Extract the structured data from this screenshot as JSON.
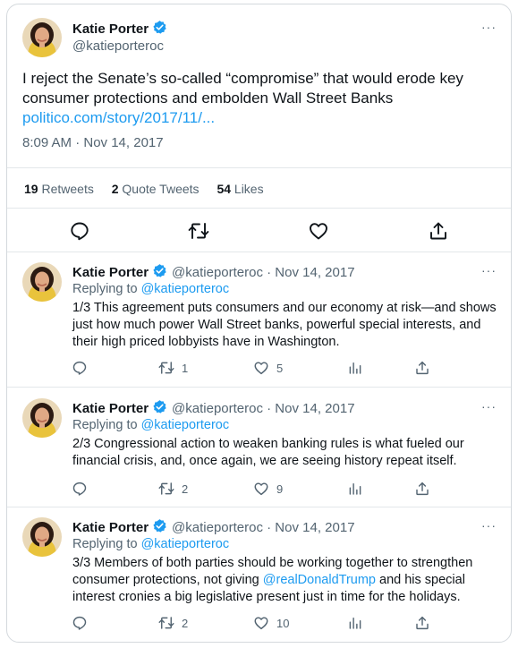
{
  "main_tweet": {
    "author_name": "Katie Porter",
    "handle": "@katieporteroc",
    "more": "···",
    "text": "I reject the Senate’s so-called “compromise” that would erode key consumer protections and embolden Wall Street Banks",
    "link": "politico.com/story/2017/11/...",
    "timestamp": "8:09 AM · Nov 14, 2017",
    "stats": {
      "retweets_count": "19",
      "retweets_label": "Retweets",
      "quotes_count": "2",
      "quotes_label": "Quote Tweets",
      "likes_count": "54",
      "likes_label": "Likes"
    }
  },
  "replies": [
    {
      "author_name": "Katie Porter",
      "meta": "@katieporteroc · Nov 14, 2017",
      "replying_prefix": "Replying to ",
      "replying_handle": "@katieporteroc",
      "text": "1/3 This agreement puts consumers and our economy at risk—and shows just how much power Wall Street banks, powerful special interests, and their high priced lobbyists have in Washington.",
      "retweets": "1",
      "likes": "5",
      "more": "···"
    },
    {
      "author_name": "Katie Porter",
      "meta": "@katieporteroc · Nov 14, 2017",
      "replying_prefix": "Replying to ",
      "replying_handle": "@katieporteroc",
      "text": "2/3 Congressional action to weaken banking rules is what fueled our financial crisis, and, once again, we are seeing history repeat itself.",
      "retweets": "2",
      "likes": "9",
      "more": "···"
    },
    {
      "author_name": "Katie Porter",
      "meta": "@katieporteroc · Nov 14, 2017",
      "replying_prefix": "Replying to ",
      "replying_handle": "@katieporteroc",
      "text_before": "3/3 Members of both parties should be working together to strengthen consumer protections, not giving ",
      "text_mention": "@realDonaldTrump",
      "text_after": " and his special interest cronies a big legislative present just in time for the holidays.",
      "retweets": "2",
      "likes": "10",
      "more": "···"
    }
  ],
  "colors": {
    "link": "#1d9bf0",
    "verified": "#1d9bf0",
    "secondary": "#536471",
    "text": "#0f1419",
    "avatar_bg": "#e9d8b8",
    "hair": "#2b1a12",
    "skin": "#e0a985",
    "top": "#e9c33c"
  },
  "icons": [
    "verified-badge-icon",
    "reply-icon",
    "retweet-icon",
    "like-icon",
    "share-icon",
    "analytics-icon",
    "more-icon"
  ]
}
